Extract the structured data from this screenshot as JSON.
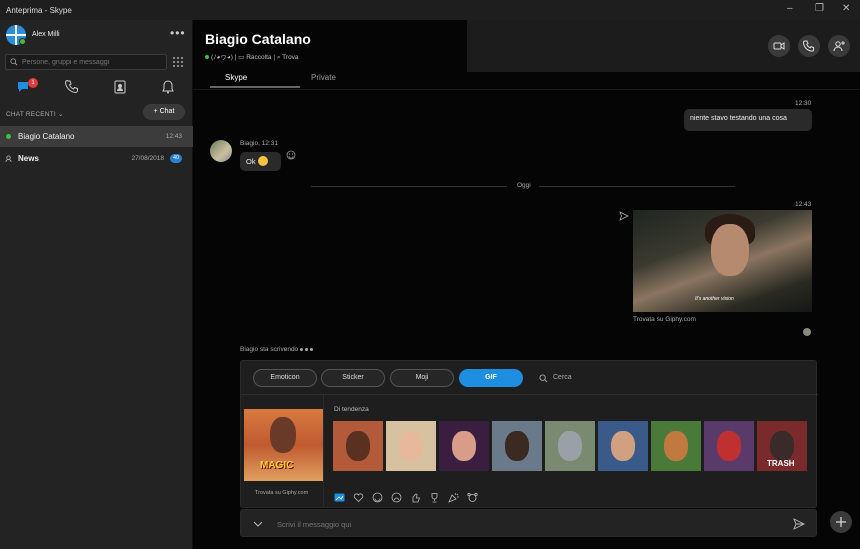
{
  "window": {
    "title": "Anteprima - Skype"
  },
  "sidebar": {
    "user_name": "Alex Milli",
    "search_placeholder": "Persone, gruppi e messaggi",
    "chat_badge": "1",
    "section_title": "CHAT RECENTI",
    "new_chat_label": "+ Chat",
    "chats": [
      {
        "name": "Biagio Catalano",
        "time": "12:43"
      },
      {
        "name": "News",
        "time": "27/08/2018",
        "badge": "40"
      }
    ]
  },
  "header": {
    "contact_name": "Biagio Catalano",
    "status_mood": "(ﾉ◕ヮ◕)",
    "gallery_label": "Raccolta",
    "find_label": "Trova",
    "tabs": [
      "Skype",
      "Private"
    ]
  },
  "conversation": {
    "outgoing_time": "12:30",
    "outgoing_text": "niente stavo testando una cosa",
    "incoming_meta": "Biagio, 12:31",
    "incoming_text": "Ok",
    "day_separator": "Oggi",
    "gif_time": "12:43",
    "gif_caption": "It's another vision",
    "gif_source": "Trovata su Giphy.com",
    "typing_text": "Biagio sta scrivendo"
  },
  "picker": {
    "tabs": [
      "Emoticon",
      "Sticker",
      "Moji",
      "GIF"
    ],
    "active_tab": "GIF",
    "search_placeholder": "Cerca",
    "featured_text": "MAGIC",
    "featured_source": "Trovata su Giphy.com",
    "trending_label": "Di tendenza",
    "thumb_text": "TRASH"
  },
  "composer": {
    "placeholder": "Scrivi il messaggio qui"
  },
  "colors": {
    "accent": "#1e8ee0",
    "online": "#3fbf3f",
    "badge_red": "#e03a3a"
  }
}
